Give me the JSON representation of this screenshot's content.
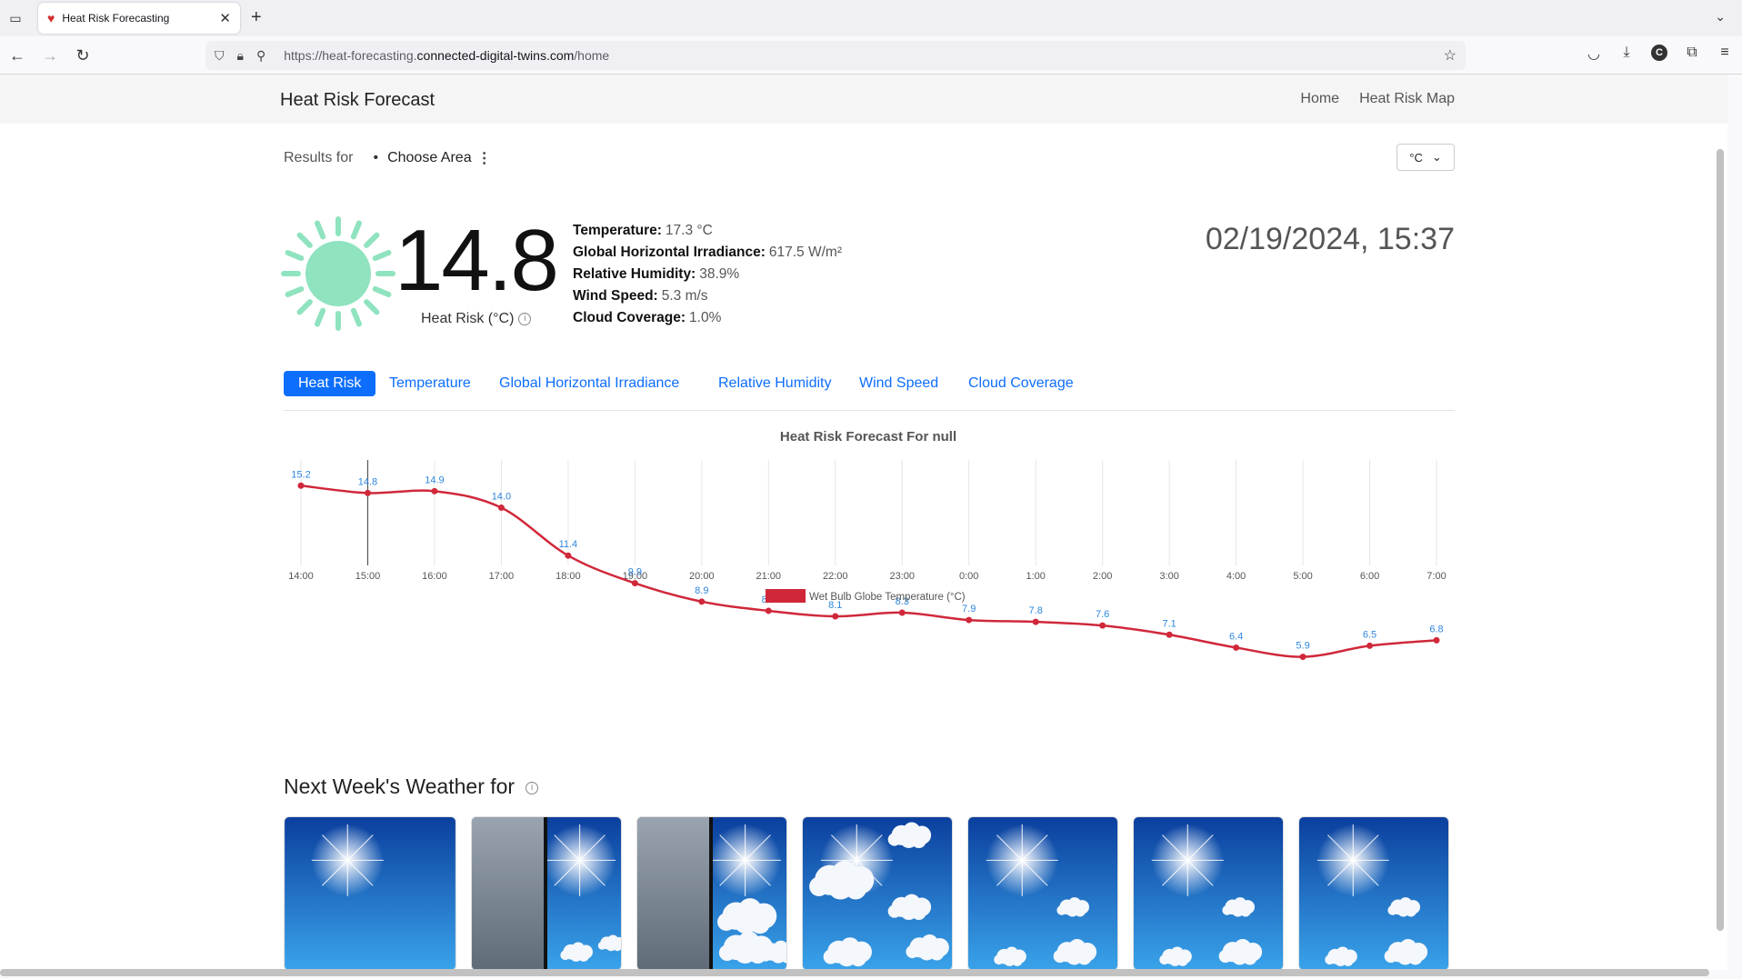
{
  "browser": {
    "tab_title": "Heat Risk Forecasting",
    "url_prefix": "https://heat-forecasting.",
    "url_host": "connected-digital-twins.com",
    "url_path": "/home"
  },
  "header": {
    "brand": "Heat Risk Forecast",
    "nav": [
      "Home",
      "Heat Risk Map"
    ]
  },
  "filters": {
    "results_for": "Results for",
    "choose_area": "Choose Area",
    "unit": "°C"
  },
  "current": {
    "heat_risk": "14.8",
    "heat_risk_label": "Heat Risk (°C)",
    "stats": [
      {
        "label": "Temperature:",
        "value": "17.3 °C"
      },
      {
        "label": "Global Horizontal Irradiance:",
        "value": "617.5 W/m²"
      },
      {
        "label": "Relative Humidity:",
        "value": "38.9%"
      },
      {
        "label": "Wind Speed:",
        "value": "5.3 m/s"
      },
      {
        "label": "Cloud Coverage:",
        "value": "1.0%"
      }
    ],
    "datetime": "02/19/2024, 15:37",
    "sun_color": "#8fe3bf"
  },
  "tabs": [
    "Heat Risk",
    "Temperature",
    "Global Horizontal Irradiance",
    "Relative Humidity",
    "Wind Speed",
    "Cloud Coverage"
  ],
  "next_week": {
    "title": "Next Week's Weather for"
  },
  "chart_data": {
    "type": "line",
    "title": "Heat Risk Forecast For null",
    "categories": [
      "14:00",
      "15:00",
      "16:00",
      "17:00",
      "18:00",
      "19:00",
      "20:00",
      "21:00",
      "22:00",
      "23:00",
      "0:00",
      "1:00",
      "2:00",
      "3:00",
      "4:00",
      "5:00",
      "6:00",
      "7:00"
    ],
    "series": [
      {
        "name": "Wet Bulb Globe Temperature (°C)",
        "values": [
          15.2,
          14.8,
          14.9,
          14.0,
          11.4,
          9.9,
          8.9,
          8.4,
          8.1,
          8.3,
          7.9,
          7.8,
          7.6,
          7.1,
          6.4,
          5.9,
          6.5,
          6.8
        ],
        "color": "#d0283a"
      }
    ],
    "legend": "bottom",
    "grid": true,
    "label_color": "#2e86de"
  }
}
